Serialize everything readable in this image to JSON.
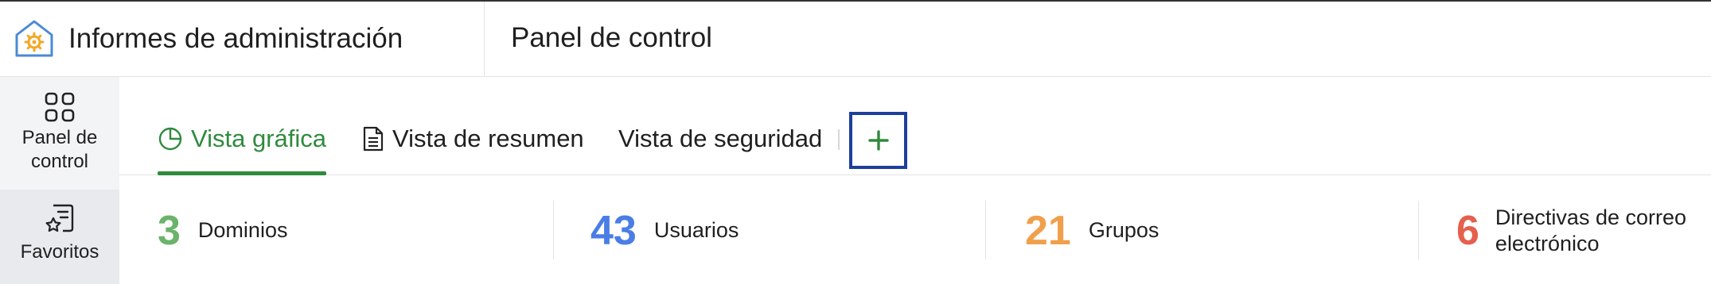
{
  "header": {
    "app_title": "Informes de administración",
    "page_title": "Panel de control"
  },
  "sidebar": {
    "items": [
      {
        "label": "Panel de control",
        "icon": "grid-icon"
      },
      {
        "label": "Favoritos",
        "icon": "star-document-icon"
      }
    ]
  },
  "tabs": {
    "items": [
      {
        "label": "Vista gráfica",
        "icon": "pie-chart-icon",
        "active": true
      },
      {
        "label": "Vista de resumen",
        "icon": "document-icon",
        "active": false
      },
      {
        "label": "Vista de seguridad",
        "active": false
      }
    ],
    "add_icon": "plus-icon"
  },
  "stats": [
    {
      "value": "3",
      "label": "Dominios",
      "color": "#6bb36a"
    },
    {
      "value": "43",
      "label": "Usuarios",
      "color": "#4a7de6"
    },
    {
      "value": "21",
      "label": "Grupos",
      "color": "#f0a04b"
    },
    {
      "value": "6",
      "label": "Directivas de correo electrónico",
      "color": "#e5604d"
    }
  ],
  "colors": {
    "accent_green": "#2f8a3e",
    "focus_border": "#1d3f9b",
    "logo_outline": "#4a8ad6",
    "logo_gear": "#f5a623"
  }
}
